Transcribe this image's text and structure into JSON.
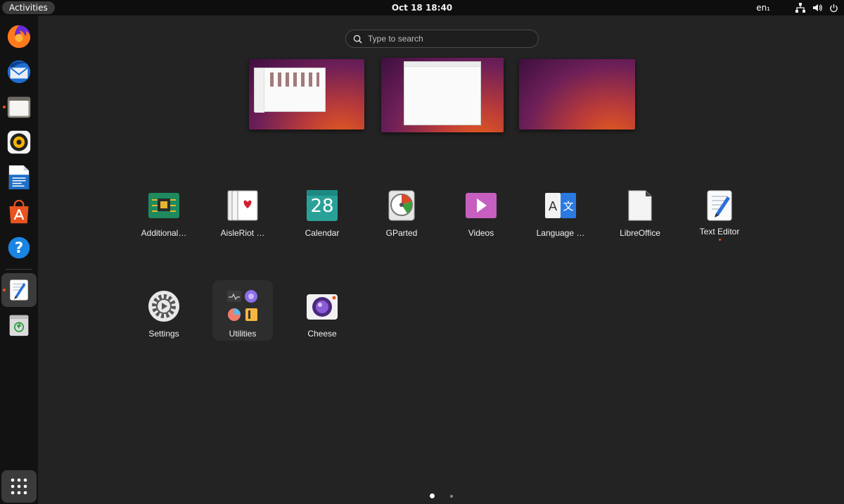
{
  "topbar": {
    "activities": "Activities",
    "clock": "Oct 18  18:40",
    "language": "en₁",
    "icons": [
      "network-icon",
      "volume-icon",
      "power-icon"
    ]
  },
  "dock": {
    "items": [
      {
        "name": "firefox",
        "icon": "firefox-icon",
        "running": false
      },
      {
        "name": "thunderbird",
        "icon": "thunderbird-icon",
        "running": false
      },
      {
        "name": "files",
        "icon": "files-icon",
        "running": true
      },
      {
        "name": "rhythmbox",
        "icon": "rhythmbox-icon",
        "running": false
      },
      {
        "name": "libreoffice-writer",
        "icon": "writer-icon",
        "running": false
      },
      {
        "name": "ubuntu-software",
        "icon": "software-icon",
        "running": false
      },
      {
        "name": "help",
        "icon": "help-icon",
        "running": false
      },
      {
        "name": "text-editor",
        "icon": "text-editor-icon",
        "running": true
      },
      {
        "name": "trash",
        "icon": "trash-icon",
        "running": false
      }
    ],
    "show_apps_icon": "app-grid-icon"
  },
  "search": {
    "placeholder": "Type to search"
  },
  "apps": {
    "row1": [
      {
        "label": "Additional…",
        "icon": "chip-icon"
      },
      {
        "label": "AisleRiot …",
        "icon": "cards-icon"
      },
      {
        "label": "Calendar",
        "icon": "calendar-icon",
        "day": "28"
      },
      {
        "label": "GParted",
        "icon": "gparted-icon"
      },
      {
        "label": "Videos",
        "icon": "videos-icon"
      },
      {
        "label": "Language …",
        "icon": "language-icon"
      },
      {
        "label": "LibreOffice",
        "icon": "libreoffice-icon"
      },
      {
        "label": "Text Editor",
        "icon": "text-editor-icon",
        "running": true
      }
    ],
    "row2": [
      {
        "label": "Settings",
        "icon": "settings-icon"
      },
      {
        "label": "Utilities",
        "icon": "utilities-folder-icon"
      },
      {
        "label": "Cheese",
        "icon": "cheese-icon"
      }
    ]
  },
  "colors": {
    "accent": "#e95420",
    "background": "#232323",
    "dock": "#121212"
  },
  "pages": {
    "count": 2,
    "current": 1
  }
}
